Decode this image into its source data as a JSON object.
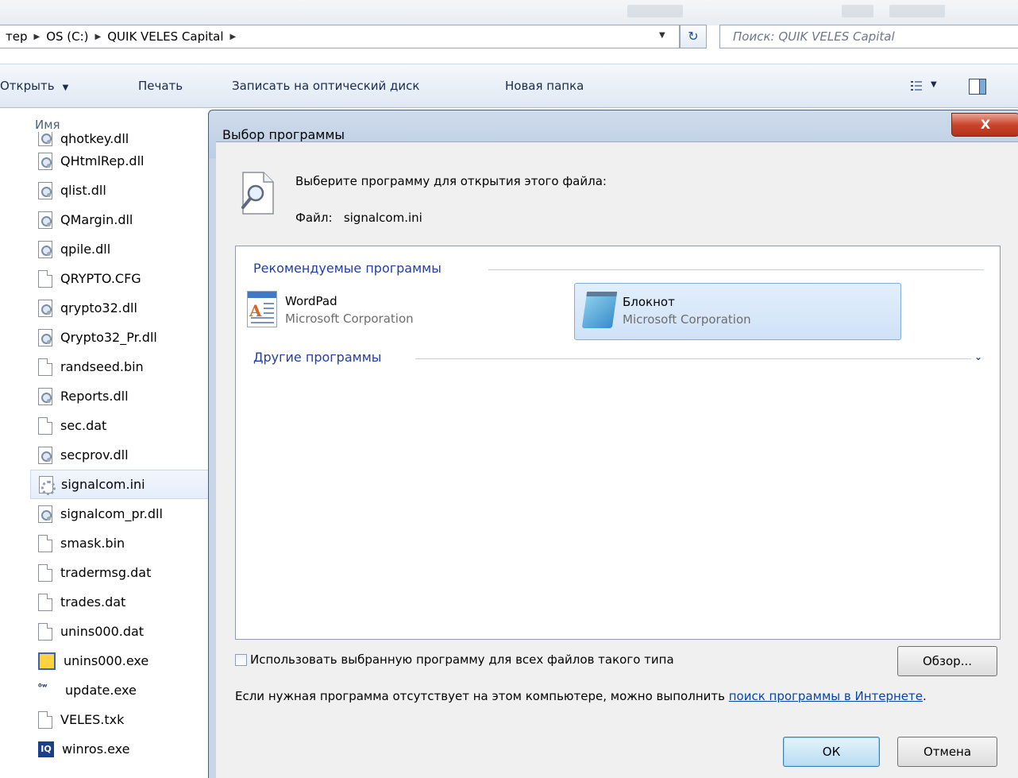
{
  "address": {
    "crumbs": [
      "тер",
      "OS (C:)",
      "QUIK VELES Capital"
    ],
    "separator": "▶",
    "refresh_glyph": "↻",
    "dropdown_glyph": "▼"
  },
  "search": {
    "placeholder": "Поиск: QUIK VELES Capital"
  },
  "toolbar": {
    "open_label": "Открыть",
    "print_label": "Печать",
    "burn_label": "Записать на оптический диск",
    "newfolder_label": "Новая папка",
    "dropdown_glyph": "▼"
  },
  "filelist": {
    "column_name": "Имя",
    "files": [
      {
        "name": "qhotkey.dll",
        "icon": "dll-icon"
      },
      {
        "name": "QHtmlRep.dll",
        "icon": "dll-icon"
      },
      {
        "name": "qlist.dll",
        "icon": "dll-icon"
      },
      {
        "name": "QMargin.dll",
        "icon": "dll-icon"
      },
      {
        "name": "qpile.dll",
        "icon": "dll-icon"
      },
      {
        "name": "QRYPTO.CFG",
        "icon": "blank-file-icon"
      },
      {
        "name": "qrypto32.dll",
        "icon": "dll-icon"
      },
      {
        "name": "Qrypto32_Pr.dll",
        "icon": "dll-icon"
      },
      {
        "name": "randseed.bin",
        "icon": "blank-file-icon"
      },
      {
        "name": "Reports.dll",
        "icon": "dll-icon"
      },
      {
        "name": "sec.dat",
        "icon": "blank-file-icon"
      },
      {
        "name": "secprov.dll",
        "icon": "dll-icon"
      },
      {
        "name": "signalcom.ini",
        "icon": "ini-icon",
        "selected": true
      },
      {
        "name": "signalcom_pr.dll",
        "icon": "dll-icon"
      },
      {
        "name": "smask.bin",
        "icon": "blank-file-icon"
      },
      {
        "name": "tradermsg.dat",
        "icon": "blank-file-icon"
      },
      {
        "name": "trades.dat",
        "icon": "blank-file-icon"
      },
      {
        "name": "unins000.dat",
        "icon": "blank-file-icon"
      },
      {
        "name": "unins000.exe",
        "icon": "setup-exe-icon"
      },
      {
        "name": "update.exe",
        "icon": "update-exe-icon"
      },
      {
        "name": "VELES.txk",
        "icon": "blank-file-icon"
      },
      {
        "name": "winros.exe",
        "icon": "iq-exe-icon"
      }
    ]
  },
  "dialog": {
    "title": "Выбор программы",
    "close_glyph": "X",
    "prompt": "Выберите программу для открытия этого файла:",
    "file_label": "Файл:",
    "file_name": "signalcom.ini",
    "recommended_header": "Рекомендуемые программы",
    "other_header": "Другие программы",
    "other_chevron": "⌄",
    "programs": [
      {
        "name": "WordPad",
        "vendor": "Microsoft Corporation",
        "selected": false
      },
      {
        "name": "Блокнот",
        "vendor": "Microsoft Corporation",
        "selected": true
      }
    ],
    "always_use_label": "Использовать выбранную программу для всех файлов такого типа",
    "always_use_checked": false,
    "browse_label": "Обзор...",
    "info_text": "Если нужная программа отсутствует на этом компьютере, можно выполнить ",
    "info_link": "поиск программы в Интернете",
    "info_end": ".",
    "ok_label": "ОК",
    "cancel_label": "Отмена"
  },
  "colors": {
    "accent_blue": "#1f3fa6",
    "selection_bg": "#cfe2f7",
    "close_red": "#c9452c"
  }
}
